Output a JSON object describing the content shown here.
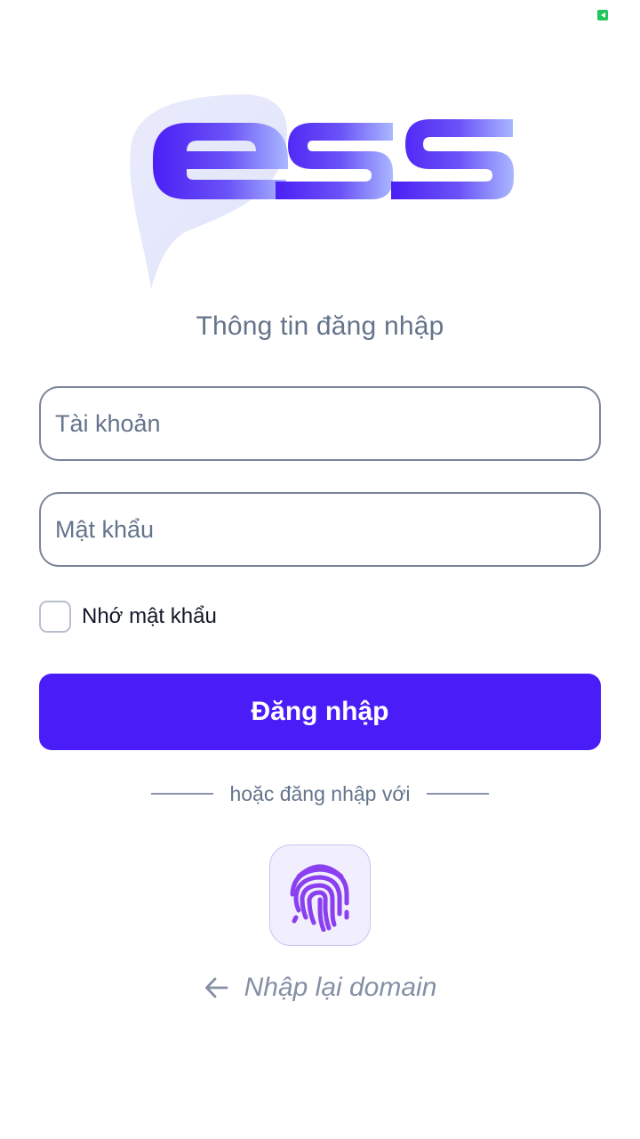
{
  "logo": {
    "text": "ess",
    "colors": {
      "start": "#4b1ff5",
      "end": "#aab8ff",
      "bubble": "#e3e6fb"
    }
  },
  "title": "Thông tin đăng nhập",
  "form": {
    "username_placeholder": "Tài khoản",
    "password_placeholder": "Mật khẩu",
    "remember_label": "Nhớ mật khẩu",
    "remember_checked": false,
    "submit_label": "Đăng nhập"
  },
  "alt_login": {
    "divider_text": "hoặc đăng nhập với",
    "fingerprint_icon": "fingerprint-icon"
  },
  "back": {
    "label": "Nhập lại domain",
    "icon": "arrow-left-icon"
  },
  "colors": {
    "primary": "#4a1cf7",
    "muted_text": "#64748b",
    "fingerprint_bg": "#f1eefe",
    "fingerprint_stroke": "#8a3ff0"
  }
}
